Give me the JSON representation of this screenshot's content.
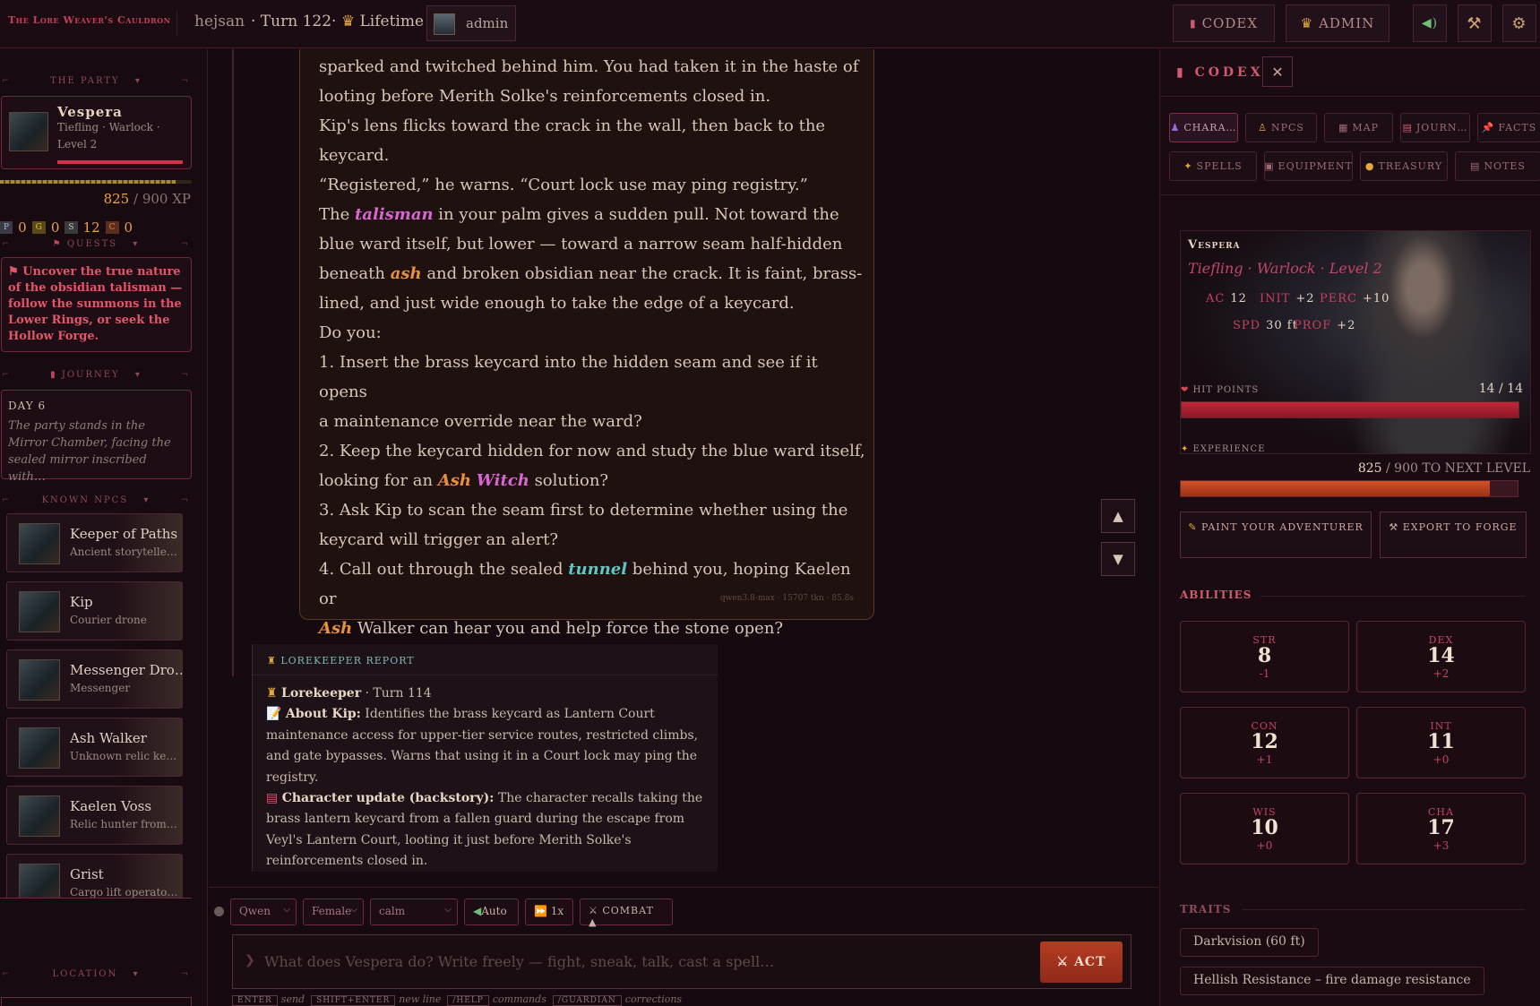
{
  "topbar": {
    "logo": "The Lore Weaver's Cauldron",
    "user": "hejsan",
    "turn": "· Turn 122·",
    "lifetime": "Lifetime",
    "admin_chip": "admin",
    "codex_btn": "CODEX",
    "admin_btn": "ADMIN"
  },
  "left": {
    "party_header": "THE PARTY",
    "hero": {
      "name": "Vespera",
      "info": "Tiefling · Warlock · Level 2"
    },
    "xp": {
      "current": "825",
      "max": "/ 900 XP"
    },
    "coins": [
      {
        "label": "P",
        "value": "0"
      },
      {
        "label": "G",
        "value": "0"
      },
      {
        "label": "S",
        "value": "12"
      },
      {
        "label": "C",
        "value": "0"
      }
    ],
    "quests_header": "QUESTS",
    "quest_text": "Uncover the true nature of the obsidian talisman — follow the summons in the Lower Rings, or seek the Hollow Forge.",
    "journey_header": "JOURNEY",
    "journey_day": "DAY 6",
    "journey_text": "The party stands in the Mirror Chamber, facing the sealed mirror inscribed with…",
    "npcs_header": "KNOWN NPCS",
    "npcs": [
      {
        "name": "Keeper of Paths",
        "desc": "Ancient storytelle…"
      },
      {
        "name": "Kip",
        "desc": "Courier drone"
      },
      {
        "name": "Messenger Dro…",
        "desc": "Messenger"
      },
      {
        "name": "Ash Walker",
        "desc": "Unknown relic ke…"
      },
      {
        "name": "Kaelen Voss",
        "desc": "Relic hunter from…"
      },
      {
        "name": "Grist",
        "desc": "Cargo lift operato…"
      }
    ],
    "location_header": "LOCATION"
  },
  "story": {
    "l1": "sparked and twitched behind him. You had taken it in the haste of",
    "l2": "looting before Merith Solke's reinforcements closed in.",
    "l3": "Kip's lens flicks toward the crack in the wall, then back to the",
    "l4": "keycard.",
    "l5": "“Registered,” he warns. “Court lock use may ping registry.”",
    "p6a": "The ",
    "kw_talisman": "talisman",
    "p6b": " in your palm gives a sudden pull. Not toward the",
    "l7": "blue ward itself, but lower — toward a narrow seam half-hidden",
    "p8a": "beneath ",
    "kw_ash1": "ash",
    "p8b": " and broken obsidian near the crack. It is faint, brass-",
    "l9": "lined, and just wide enough to take the edge of a keycard.",
    "l10": "Do you:",
    "o1a": "1. Insert the brass keycard into the hidden seam and see if it opens",
    "o1b": "a maintenance override near the ward?",
    "o2a": "2. Keep the keycard hidden for now and study the blue ward itself,",
    "o2b_pre": "looking for an ",
    "kw_ash2": "Ash",
    "kw_witch": "Witch",
    "o2b_post": " solution?",
    "o3a": "3. Ask Kip to scan the seam first to determine whether using the",
    "o3b": "keycard will trigger an alert?",
    "o4a_pre": "4. Call out through the sealed ",
    "kw_tunnel": "tunnel",
    "o4a_post": " behind you, hoping Kaelen or",
    "kw_ash3": "Ash",
    "o4b_post": " Walker can hear you and help force the stone open?",
    "meta": "qwen3.8-max · 15707 tkn · 85.8s"
  },
  "report": {
    "header": "LOREKEEPER REPORT",
    "who": "Lorekeeper",
    "turn": " · Turn 114",
    "about_label": "About Kip:",
    "about_text": " Identifies the brass keycard as Lantern Court maintenance access for upper-tier service routes, restricted climbs, and gate bypasses. Warns that using it in a Court lock may ping the registry.",
    "update_label": "Character update",
    "update_paren": " (backstory):",
    "update_text": " The character recalls taking the brass lantern keycard from a fallen guard during the escape from Veyl's Lantern Court, looting it just before Merith Solke's reinforcements closed in."
  },
  "input": {
    "model": "Qwen",
    "voice": "Female",
    "tone": "calm",
    "auto": "Auto",
    "speed": "1x",
    "combat": "COMBAT",
    "placeholder": "What does Vespera do? Write freely — fight, sneak, talk, cast a spell…",
    "act": "ACT",
    "hints": [
      {
        "key": "ENTER",
        "text": "send"
      },
      {
        "key": "SHIFT+ENTER",
        "text": "new line"
      },
      {
        "key": "/HELP",
        "text": "commands"
      },
      {
        "key": "/GUARDIAN",
        "text": "corrections"
      }
    ]
  },
  "codex": {
    "title": "CODEX",
    "tabs_row1": [
      "CHARA…",
      "NPCS",
      "MAP",
      "JOURN…",
      "FACTS"
    ],
    "tabs_row2": [
      "SPELLS",
      "EQUIPMENT",
      "TREASURY",
      "NOTES"
    ],
    "sheet": {
      "name": "Vespera",
      "sub": "Tiefling · Warlock · Level 2",
      "ac": "12",
      "init": "+2",
      "perc": "+10",
      "spd": "30 ft",
      "prof": "+2",
      "hp_label": "HIT POINTS",
      "hp_value": "14 / 14",
      "hp_fraction": 1.0,
      "xp_label": "EXPERIENCE",
      "xp_value": "825",
      "xp_rest": "/ 900 TO NEXT LEVEL",
      "xp_fraction": 0.917
    },
    "paint_btn": "PAINT YOUR ADVENTURER",
    "export_btn": "EXPORT TO FORGE",
    "abilities_header": "ABILITIES",
    "abilities": [
      {
        "k": "STR",
        "v": "8",
        "m": "-1"
      },
      {
        "k": "DEX",
        "v": "14",
        "m": "+2"
      },
      {
        "k": "CON",
        "v": "12",
        "m": "+1"
      },
      {
        "k": "INT",
        "v": "11",
        "m": "+0"
      },
      {
        "k": "WIS",
        "v": "10",
        "m": "+0"
      },
      {
        "k": "CHA",
        "v": "17",
        "m": "+3"
      }
    ],
    "traits_header": "TRAITS",
    "traits": [
      "Darkvision (60 ft)",
      "Hellish Resistance – fire damage resistance"
    ]
  },
  "colors": {
    "accent": "#c0415a",
    "act": "#b53c23",
    "hp": "#b01c2e",
    "xp": "#c0441e"
  }
}
